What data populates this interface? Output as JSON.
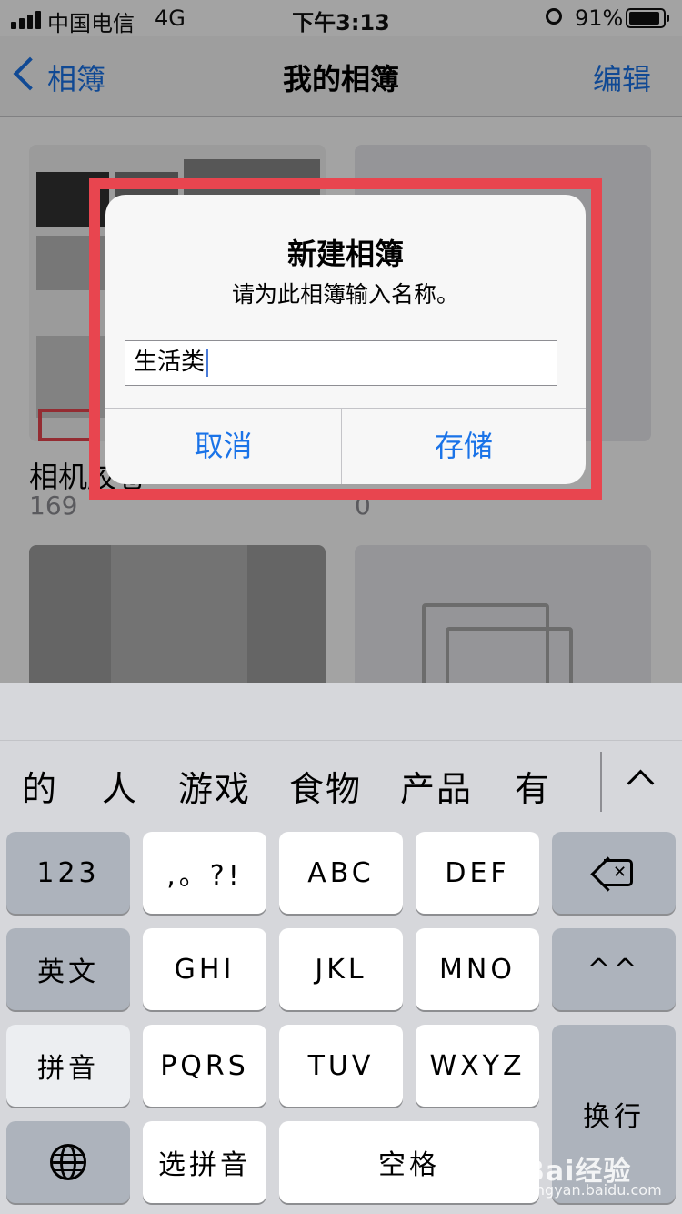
{
  "status_bar": {
    "carrier": "中国电信",
    "network": "4G",
    "time": "下午3:13",
    "battery_percent": "91%",
    "battery_level": 0.91
  },
  "nav": {
    "back_label": "相簿",
    "title": "我的相簿",
    "edit_label": "编辑"
  },
  "albums": [
    {
      "name": "相机胶卷",
      "count": "169"
    },
    {
      "name": "",
      "count": "0"
    }
  ],
  "alert": {
    "title": "新建相簿",
    "message": "请为此相簿输入名称。",
    "input_value": "生活类",
    "cancel_label": "取消",
    "save_label": "存储",
    "highlight_color": "#e8454f"
  },
  "keyboard": {
    "candidates": [
      "的",
      "人",
      "游戏",
      "食物",
      "产品",
      "有"
    ],
    "keys": {
      "num": "123",
      "punct": ",。?!",
      "abc": "ABC",
      "def": "DEF",
      "english": "英文",
      "ghi": "GHI",
      "jkl": "JKL",
      "mno": "MNO",
      "emoji": "^^",
      "pinyin": "拼音",
      "pqrs": "PQRS",
      "tuv": "TUV",
      "wxyz": "WXYZ",
      "return": "换行",
      "select_pinyin": "选拼音",
      "space": "空格"
    }
  },
  "watermark": {
    "brand": "Bai经验",
    "url": "jingyan.baidu.com"
  },
  "colors": {
    "accent": "#1a73e8",
    "highlight": "#e8454f",
    "keyboard_bg": "#d6d7db"
  }
}
